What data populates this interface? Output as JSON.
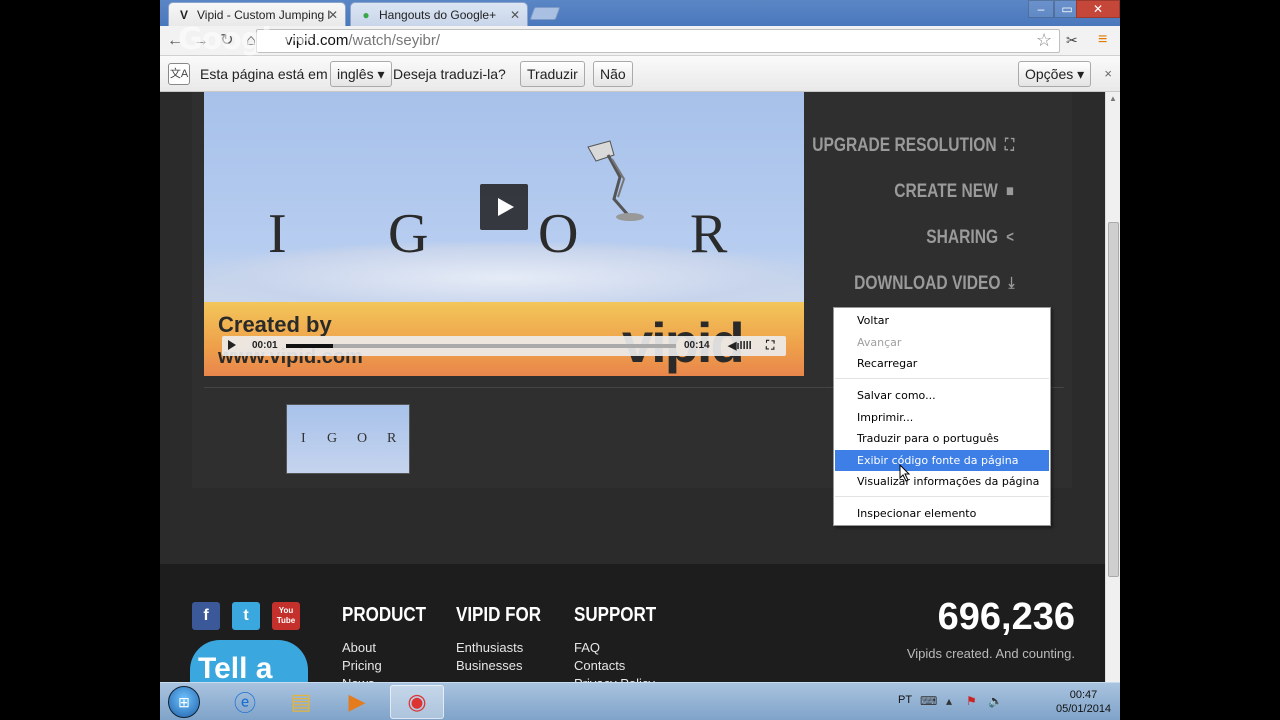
{
  "browser": {
    "tabs": [
      {
        "label": "Vipid - Custom Jumping l",
        "favicon": "V",
        "active": true
      },
      {
        "label": "Hangouts do Google+",
        "favicon": "●",
        "active": false
      }
    ],
    "url_host": "vipid.com",
    "url_path": "/watch/seyibr/",
    "overlay_watermark": "Google+"
  },
  "translate_bar": {
    "icon": "文A",
    "prefix": "Esta página está em",
    "language": "inglês",
    "question": "Deseja traduzi-la?",
    "translate_button": "Traduzir",
    "no_button": "Não",
    "options_button": "Opções",
    "close": "×"
  },
  "video": {
    "title_letters": [
      "I",
      "G",
      "O",
      "R"
    ],
    "created_by": "Created by",
    "site": "www.vipid.com",
    "logo": "vipid",
    "time_current": "00:01",
    "time_total": "00:14",
    "progress": 0.12
  },
  "thumbnail": {
    "letters": [
      "I",
      "G",
      "O",
      "R"
    ]
  },
  "actions": [
    {
      "label": "UPGRADE RESOLUTION",
      "icon": "⛶"
    },
    {
      "label": "CREATE NEW",
      "icon": "■"
    },
    {
      "label": "SHARING",
      "icon": "<"
    },
    {
      "label": "DOWNLOAD VIDEO",
      "icon": "⤓"
    }
  ],
  "context_menu": {
    "items": [
      {
        "label": "Voltar",
        "state": "normal"
      },
      {
        "label": "Avançar",
        "state": "disabled"
      },
      {
        "label": "Recarregar",
        "state": "normal"
      },
      {
        "label": "Salvar como...",
        "state": "normal"
      },
      {
        "label": "Imprimir...",
        "state": "normal"
      },
      {
        "label": "Traduzir para o português",
        "state": "normal"
      },
      {
        "label": "Exibir código fonte da página",
        "state": "highlighted"
      },
      {
        "label": "Visualizar informações da página",
        "state": "normal"
      },
      {
        "label": "Inspecionar elemento",
        "state": "normal"
      }
    ]
  },
  "footer": {
    "social": [
      "f",
      "t",
      "You Tube"
    ],
    "tell_badge": "Tell a",
    "columns": [
      {
        "heading": "PRODUCT",
        "links": [
          "About",
          "Pricing",
          "News"
        ]
      },
      {
        "heading": "VIPID FOR",
        "links": [
          "Enthusiasts",
          "Businesses"
        ]
      },
      {
        "heading": "SUPPORT",
        "links": [
          "FAQ",
          "Contacts",
          "Privacy Policy"
        ]
      }
    ],
    "counter": "696,236",
    "counter_caption": "Vipids created. And counting."
  },
  "taskbar": {
    "language": "PT",
    "time": "00:47",
    "date": "05/01/2014"
  },
  "colors": {
    "highlight": "#3d7fe6",
    "page_bg": "#2b2b2b",
    "action_text": "#9a9a9a"
  }
}
